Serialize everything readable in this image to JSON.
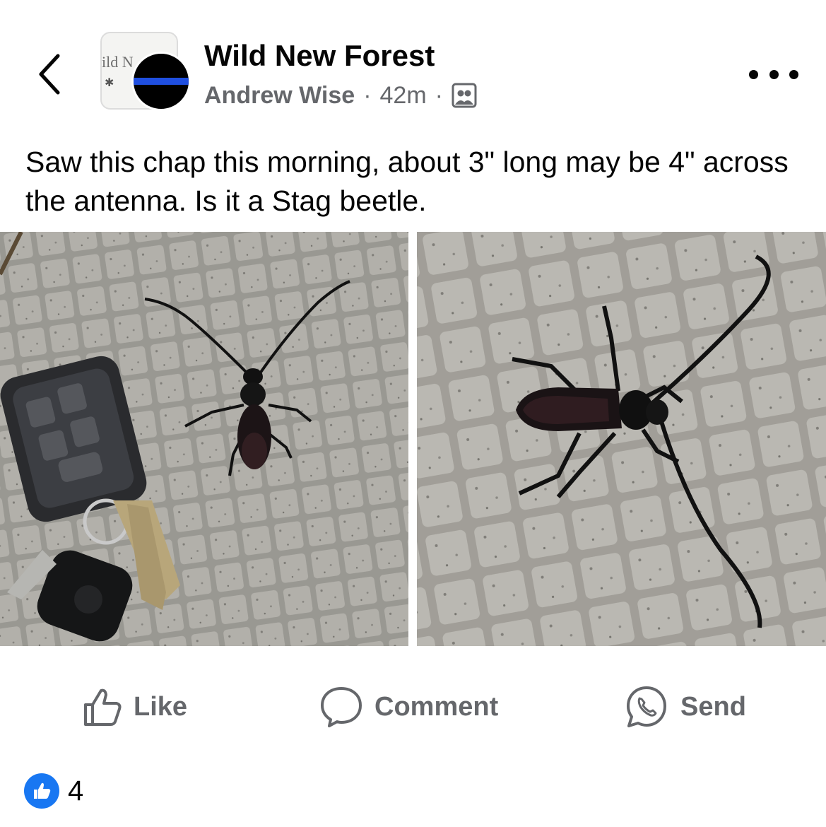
{
  "header": {
    "group_name": "Wild New Forest",
    "group_pic_text": "ild N",
    "author": "Andrew Wise",
    "separator": "·",
    "time": "42m",
    "audience_icon": "group-members-icon",
    "back_icon": "chevron-left-icon",
    "more_icon": "more-dots-icon"
  },
  "post": {
    "text": "Saw this chap this morning, about 3\" long may be 4\" across the antenna. Is it a Stag beetle."
  },
  "photos": [
    {
      "icon": "beetle-with-car-keys-photo"
    },
    {
      "icon": "beetle-closeup-photo"
    }
  ],
  "actions": {
    "like_label": "Like",
    "comment_label": "Comment",
    "send_label": "Send"
  },
  "reactions": {
    "count": "4"
  },
  "colors": {
    "text": "#050505",
    "secondary_text": "#65676b",
    "like_blue": "#1877f2",
    "stripe_blue": "#1f4fe0"
  }
}
